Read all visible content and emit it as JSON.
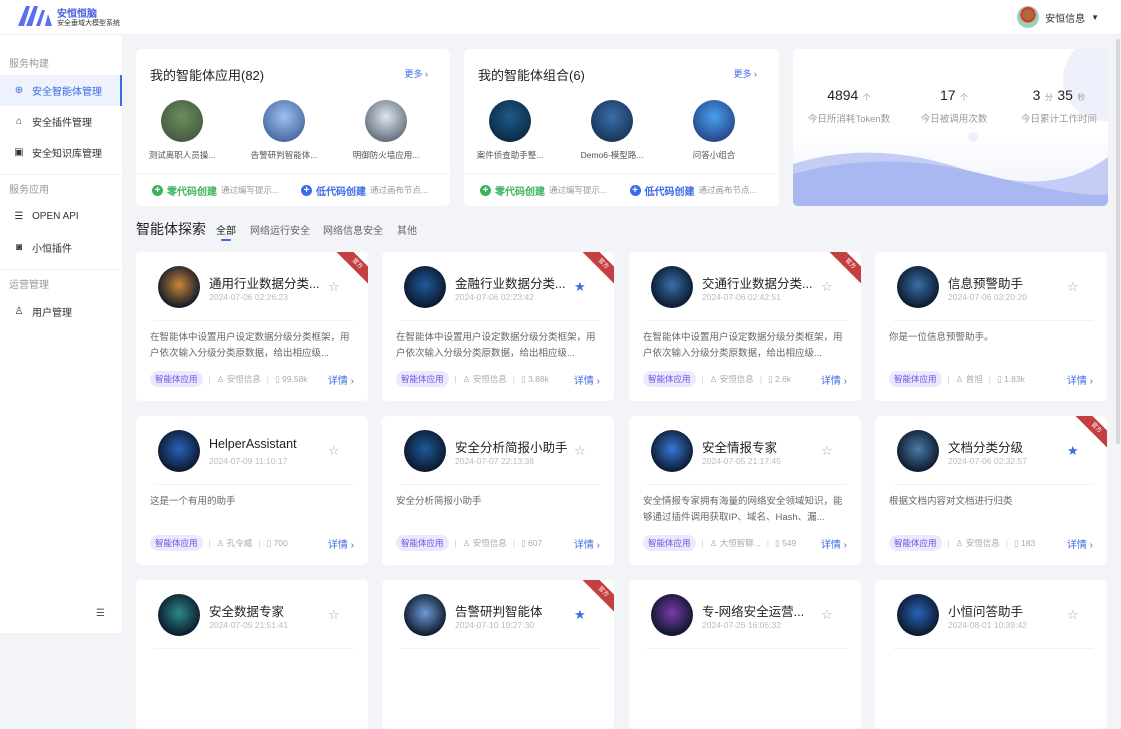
{
  "header": {
    "brand": "安恒恒脑",
    "subtitle": "安全垂域大模型系统",
    "user": "安恒信息"
  },
  "sidebar": {
    "groups": [
      {
        "label": "服务构建",
        "items": [
          {
            "label": "安全智能体管理",
            "icon": "robot-icon",
            "glyph": "⊕",
            "active": true
          },
          {
            "label": "安全插件管理",
            "icon": "plugin-icon",
            "glyph": "⌂"
          },
          {
            "label": "安全知识库管理",
            "icon": "book-icon",
            "glyph": "▣"
          }
        ]
      },
      {
        "label": "服务应用",
        "items": [
          {
            "label": "OPEN API",
            "icon": "sliders-icon",
            "glyph": "☰"
          },
          {
            "label": "小恒插件",
            "icon": "bot-face-icon",
            "glyph": "◙"
          }
        ]
      },
      {
        "label": "运营管理",
        "items": [
          {
            "label": "用户管理",
            "icon": "user-icon",
            "glyph": "♙"
          }
        ]
      }
    ]
  },
  "apps": {
    "title": "我的智能体应用(82)",
    "more": "更多",
    "items": [
      "测试离职人员操...",
      "告警研判智能体...",
      "明御防火墙应用..."
    ]
  },
  "combos": {
    "title": "我的智能体组合(6)",
    "more": "更多",
    "items": [
      "案件侦查助手整...",
      "Demo6-模型路...",
      "问答小组合"
    ]
  },
  "create": {
    "zero_label": "零代码创建",
    "zero_desc": "通过编写提示...",
    "low_label": "低代码创建",
    "low_desc": "通过画布节点..."
  },
  "stats": [
    {
      "value": "4894",
      "unit": "个",
      "label": "今日所消耗Token数"
    },
    {
      "value": "17",
      "unit": "个",
      "label": "今日被调用次数"
    },
    {
      "value": "3",
      "unit": "分",
      "value2": "35",
      "unit2": "秒",
      "label": "今日累计工作时间"
    }
  ],
  "explore": {
    "title": "智能体探索",
    "tabs": [
      "全部",
      "网络运行安全",
      "网络信息安全",
      "其他"
    ]
  },
  "ribbon_label": "官方",
  "detail_label": "详情",
  "agents": [
    {
      "title": "通用行业数据分类...",
      "date": "2024-07-06 02:26:23",
      "desc": "在智能体中设置用户设定数据分级分类框架，用户依次输入分级分类原数据，给出相应级...",
      "tag": "智能体应用",
      "author": "安恒信息",
      "count": "99.58k",
      "starred": false,
      "official": true,
      "color": "#c9853a"
    },
    {
      "title": "金融行业数据分类...",
      "date": "2024-07-06 02:23:42",
      "desc": "在智能体中设置用户设定数据分级分类框架，用户依次输入分级分类原数据，给出相应级...",
      "tag": "智能体应用",
      "author": "安恒信息",
      "count": "3.88k",
      "starred": true,
      "official": true,
      "color": "#1f5a9a"
    },
    {
      "title": "交通行业数据分类...",
      "date": "2024-07-06 02:42:51",
      "desc": "在智能体中设置用户设定数据分级分类框架，用户依次输入分级分类原数据，给出相应级...",
      "tag": "智能体应用",
      "author": "安恒信息",
      "count": "2.6k",
      "starred": false,
      "official": true,
      "color": "#3a6fa8"
    },
    {
      "title": "信息预警助手",
      "date": "2024-07-06 03:20:20",
      "desc": "你是一位信息预警助手。",
      "tag": "智能体应用",
      "author": "曾旭",
      "count": "1.83k",
      "starred": false,
      "official": false,
      "color": "#3a6fa8"
    },
    {
      "title": "HelperAssistant",
      "date": "2024-07-09 11:10:17",
      "desc": "这是一个有用的助手",
      "tag": "智能体应用",
      "author": "孔令威",
      "count": "700",
      "starred": false,
      "official": false,
      "color": "#2a63b8"
    },
    {
      "title": "安全分析简报小助手",
      "date": "2024-07-07 22:13:38",
      "desc": "安全分析简报小助手",
      "tag": "智能体应用",
      "author": "安恒信息",
      "count": "607",
      "starred": false,
      "official": false,
      "color": "#1f5a9a"
    },
    {
      "title": "安全情报专家",
      "date": "2024-07-05 21:17:45",
      "desc": "安全情报专家拥有海量的网络安全领域知识，能够通过插件调用获取IP、域名、Hash、漏...",
      "tag": "智能体应用",
      "author": "大恒智聊...",
      "count": "549",
      "starred": false,
      "official": false,
      "color": "#3b78d8"
    },
    {
      "title": "文档分类分级",
      "date": "2024-07-06 02:32:57",
      "desc": "根据文档内容对文档进行归类",
      "tag": "智能体应用",
      "author": "安恒信息",
      "count": "183",
      "starred": true,
      "official": true,
      "color": "#4a7ca8"
    },
    {
      "title": "安全数据专家",
      "date": "2024-07-05 21:51:41",
      "desc": "",
      "tag": "",
      "author": "",
      "count": "",
      "starred": false,
      "official": false,
      "color": "#2b8a8a"
    },
    {
      "title": "告警研判智能体",
      "date": "2024-07-10 19:27:30",
      "desc": "",
      "tag": "",
      "author": "",
      "count": "",
      "starred": true,
      "official": true,
      "color": "#6f9ad8"
    },
    {
      "title": "专-网络安全运营...",
      "date": "2024-07-26 16:06:32",
      "desc": "",
      "tag": "",
      "author": "",
      "count": "",
      "starred": false,
      "official": false,
      "color": "#7a3aa8"
    },
    {
      "title": "小恒问答助手",
      "date": "2024-08-01 10:39:42",
      "desc": "",
      "tag": "",
      "author": "",
      "count": "",
      "starred": false,
      "official": false,
      "color": "#2a63b8"
    }
  ],
  "colors": {
    "accent": "#3d6be6",
    "green": "#3bb55c",
    "ribbon": "#c44040",
    "tag_bg": "#ece9fd"
  }
}
